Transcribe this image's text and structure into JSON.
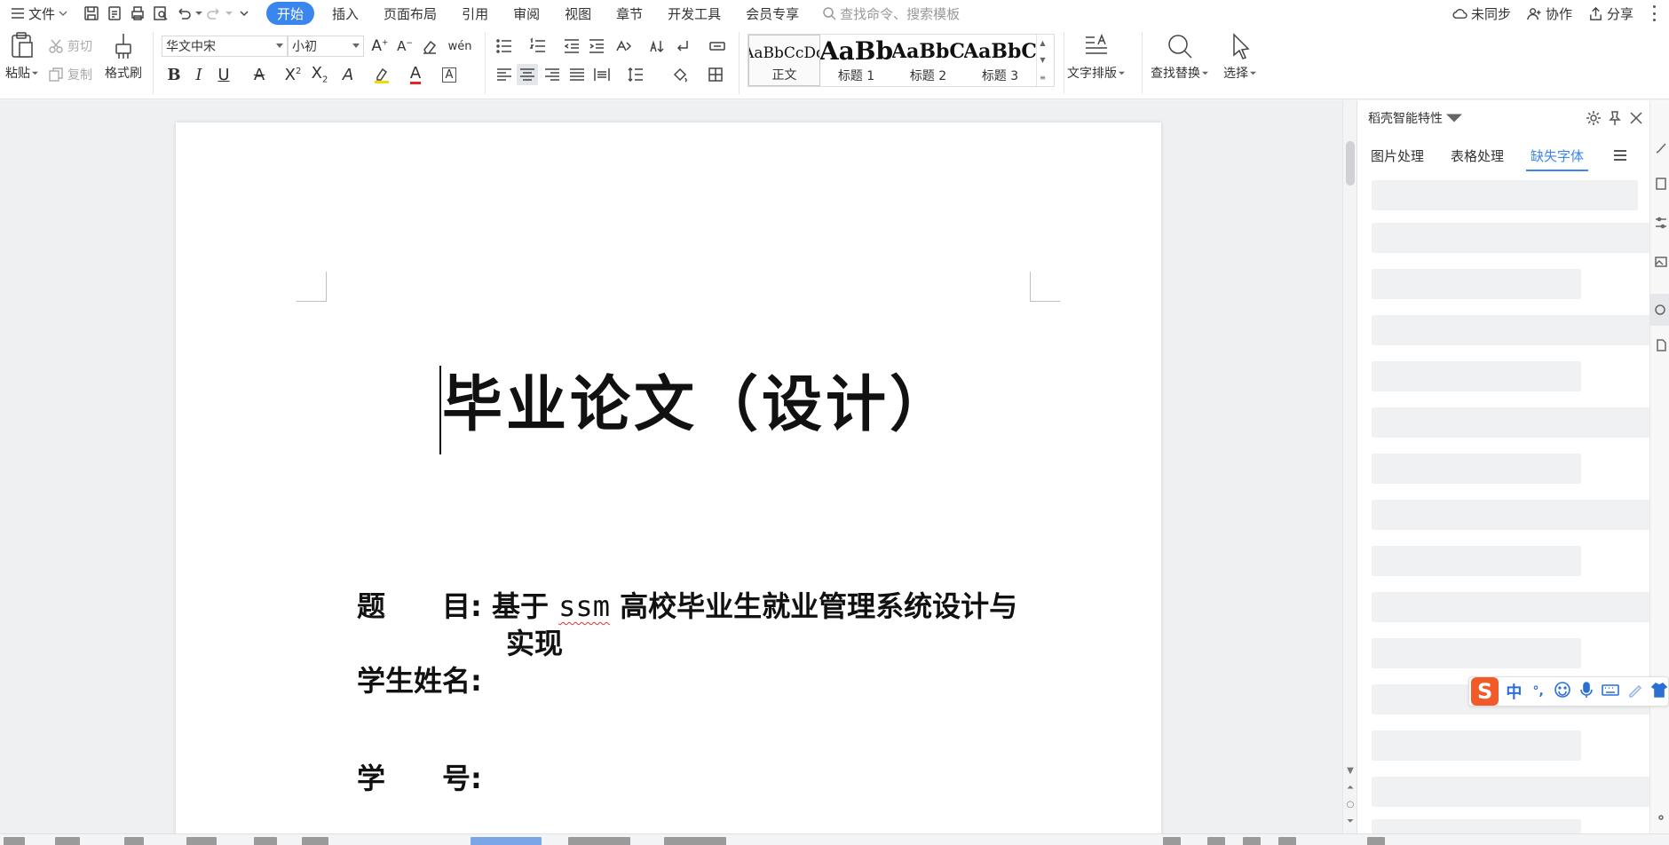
{
  "menubar": {
    "file_label": "文件",
    "tabs": [
      {
        "label": "开始",
        "active": true
      },
      {
        "label": "插入"
      },
      {
        "label": "页面布局"
      },
      {
        "label": "引用"
      },
      {
        "label": "审阅"
      },
      {
        "label": "视图"
      },
      {
        "label": "章节"
      },
      {
        "label": "开发工具"
      },
      {
        "label": "会员专享"
      }
    ],
    "search_placeholder": "查找命令、搜索模板",
    "right": {
      "sync": "未同步",
      "collab": "协作",
      "share": "分享"
    }
  },
  "ribbon": {
    "paste": "粘贴",
    "cut": "剪切",
    "copy": "复制",
    "format_painter": "格式刷",
    "font_name": "华文中宋",
    "font_size": "小初",
    "styles": [
      {
        "preview": "AaBbCcDd",
        "name": "正文"
      },
      {
        "preview": "AaBb",
        "name": "标题 1"
      },
      {
        "preview": "AaBbC",
        "name": "标题 2"
      },
      {
        "preview": "AaBbC",
        "name": "标题 3"
      }
    ],
    "text_layout": "文字排版",
    "find_replace": "查找替换",
    "select": "选择"
  },
  "document": {
    "title": "毕业论文（设计）",
    "fields": [
      {
        "label": "题　　目:",
        "value_main": "基于 ",
        "value_spell": "ssm",
        "value_rest": " 高校毕业生就业管理系统设计与",
        "value_cont": "实现"
      },
      {
        "label": "学生姓名:",
        "value": ""
      },
      {
        "label": "学　　号:",
        "value": ""
      }
    ]
  },
  "panel": {
    "title": "稻壳智能特性",
    "tabs": [
      {
        "label": "图片处理"
      },
      {
        "label": "表格处理"
      },
      {
        "label": "缺失字体",
        "active": true
      }
    ]
  },
  "ime": {
    "logo": "S",
    "mode": "中",
    "punct": "°,"
  },
  "colors": {
    "accent": "#3b86ee",
    "ime_logo": "#f25a2a",
    "spell_underline": "#dd3333"
  }
}
